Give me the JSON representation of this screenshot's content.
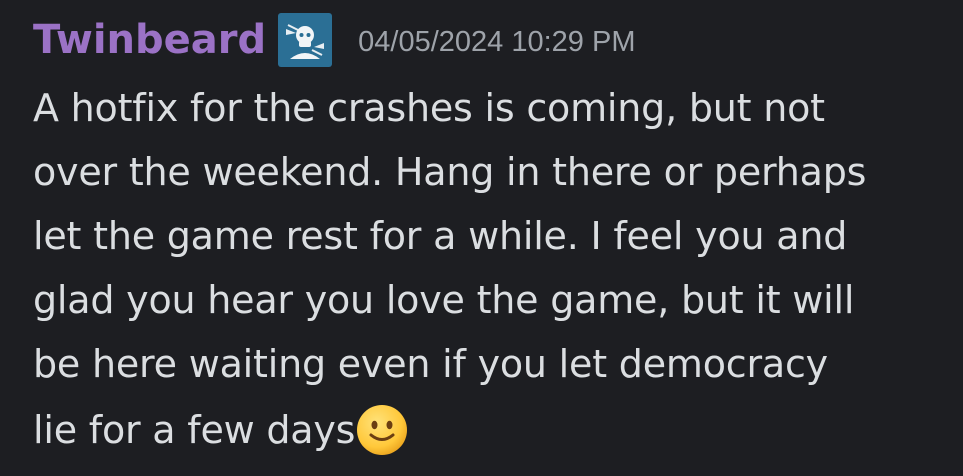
{
  "message": {
    "author": "Twinbeard",
    "author_color": "#9b72c6",
    "role_badge_icon": "helldivers-skull-badge-icon",
    "role_badge_color": "#2b6f95",
    "timestamp": "04/05/2024 10:29 PM",
    "lines": [
      "A hotfix for the crashes is coming, but not",
      "over the weekend. Hang in there or perhaps",
      "let the game rest for a while. I feel you and",
      "glad you hear you love the game, but it will",
      "be here waiting even if you let democracy",
      "lie for a few days"
    ],
    "emoji": "slightly-smiling-face-icon"
  },
  "colors": {
    "background": "#1d1e22",
    "text": "#dbdee1",
    "timestamp": "#9ea3aa"
  }
}
